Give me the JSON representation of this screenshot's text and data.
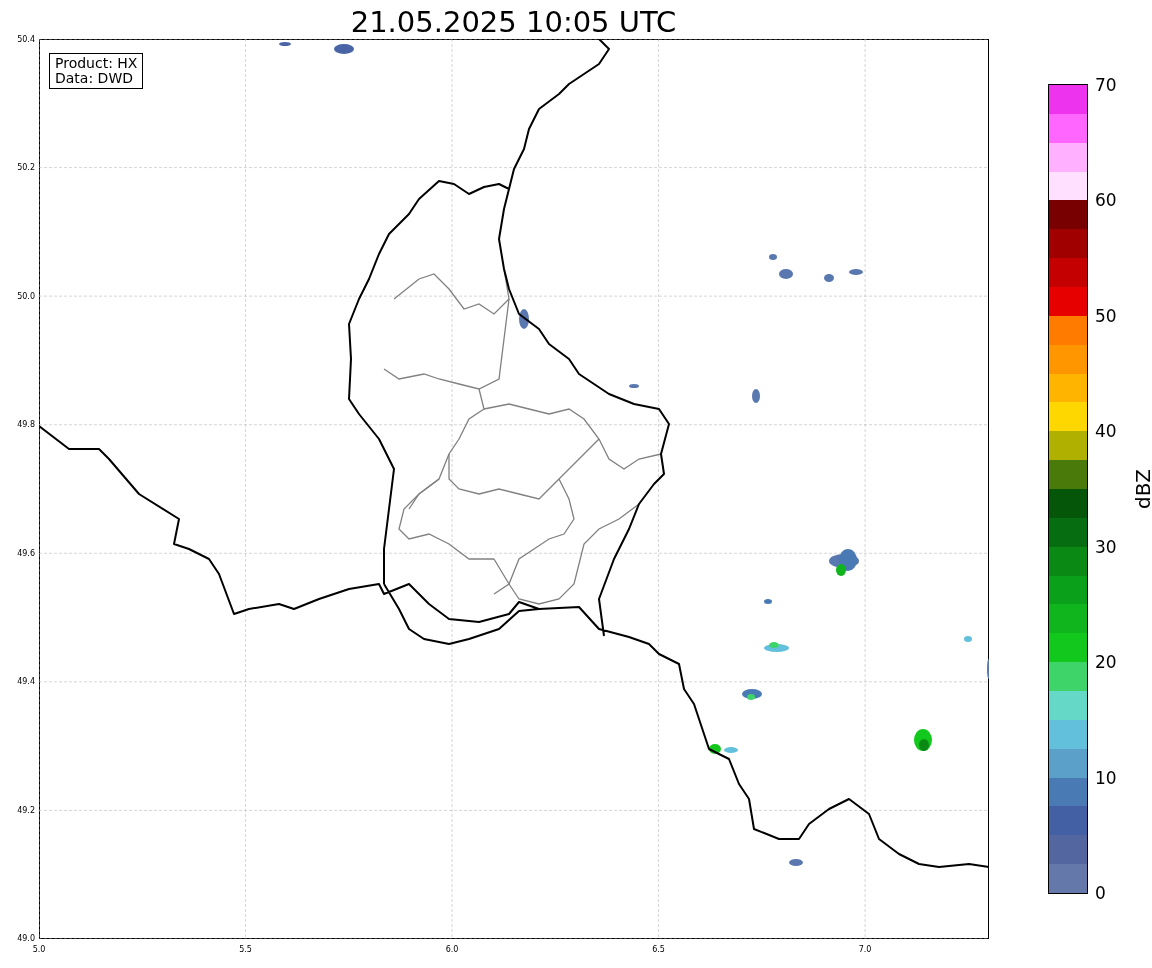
{
  "title": "21.05.2025 10:05 UTC",
  "info": [
    "Product: HX",
    "Data: DWD"
  ],
  "x_ticks": [
    "5.0",
    "5.5",
    "6.0",
    "6.5",
    "7.0"
  ],
  "y_ticks": [
    "50.4",
    "50.2",
    "50.0",
    "49.8",
    "49.6",
    "49.4",
    "49.2",
    "49.0"
  ],
  "colorbar": {
    "label": "dBZ",
    "ticks": [
      "70",
      "60",
      "50",
      "40",
      "30",
      "20",
      "10",
      "0"
    ],
    "segments": [
      {
        "color": "#ee33ee"
      },
      {
        "color": "#ff66ff"
      },
      {
        "color": "#ffb0ff"
      },
      {
        "color": "#ffe0ff"
      },
      {
        "color": "#780000"
      },
      {
        "color": "#a00000"
      },
      {
        "color": "#c40000"
      },
      {
        "color": "#e60000"
      },
      {
        "color": "#ff7b00"
      },
      {
        "color": "#ff9600"
      },
      {
        "color": "#ffb400"
      },
      {
        "color": "#ffd700"
      },
      {
        "color": "#b0b000"
      },
      {
        "color": "#4a7a0a"
      },
      {
        "color": "#06560a"
      },
      {
        "color": "#066e10"
      },
      {
        "color": "#0a8a14"
      },
      {
        "color": "#0aa01a"
      },
      {
        "color": "#10b41c"
      },
      {
        "color": "#12c81c"
      },
      {
        "color": "#3ed46a"
      },
      {
        "color": "#66d8c8"
      },
      {
        "color": "#62c0dc"
      },
      {
        "color": "#5aa0c8"
      },
      {
        "color": "#4a7ab4"
      },
      {
        "color": "#4460a4"
      },
      {
        "color": "#5466a0"
      },
      {
        "color": "#6478aa"
      }
    ]
  }
}
